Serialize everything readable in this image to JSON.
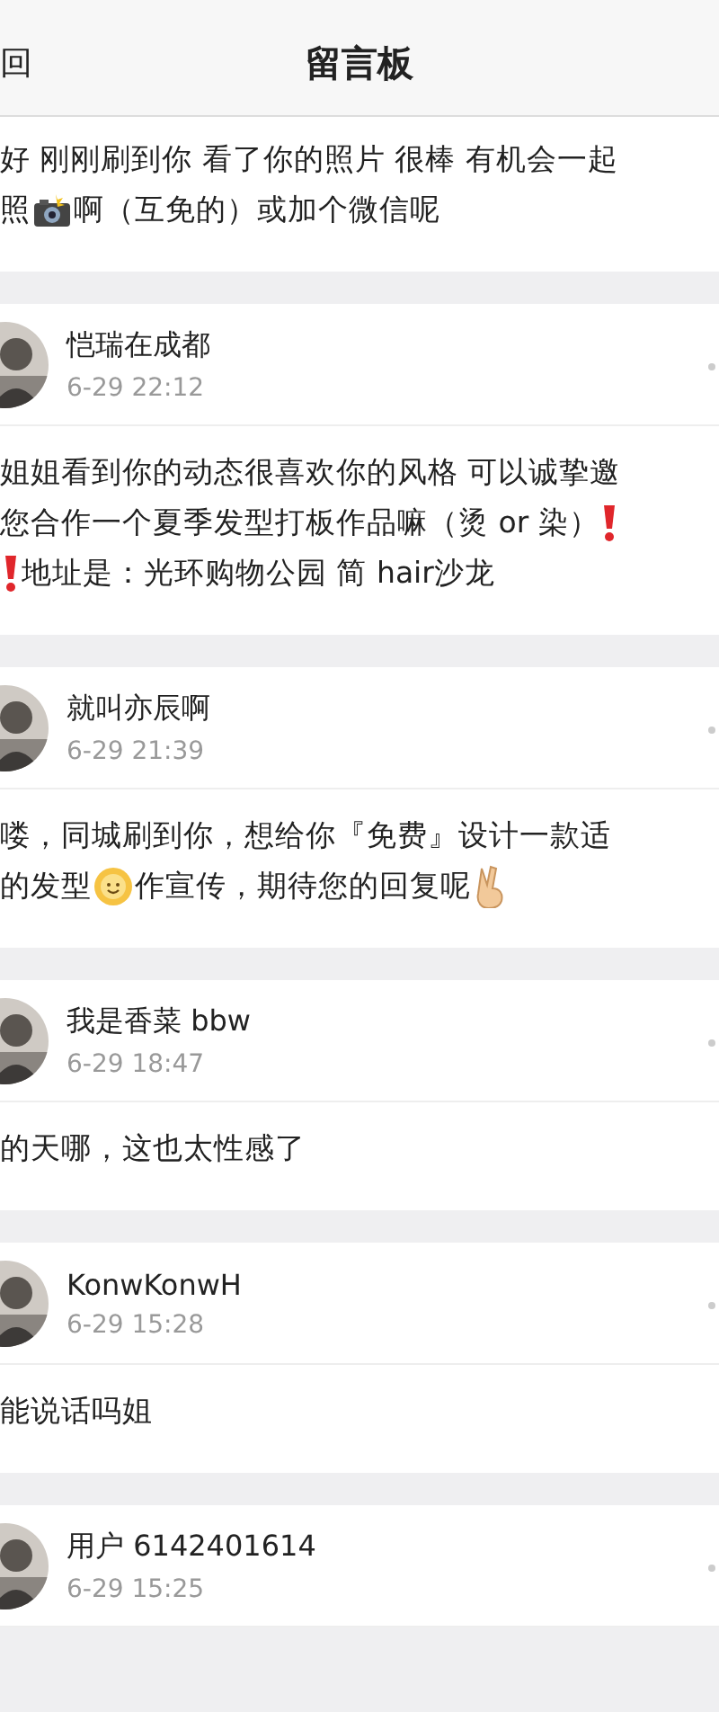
{
  "header": {
    "back": "回",
    "title": "留言板"
  },
  "messages": [
    {
      "lines": [
        [
          {
            "kind": "text",
            "text": "好  刚刚刷到你 看了你的照片 很棒 有机会一起"
          }
        ],
        [
          {
            "kind": "text",
            "text": "照"
          },
          {
            "kind": "camera"
          },
          {
            "kind": "text",
            "text": "啊（互免的）或加个微信呢"
          }
        ]
      ]
    },
    {
      "name": "恺瑞在成都",
      "time": "6-29 22:12",
      "lines": [
        [
          {
            "kind": "text",
            "text": "姐姐看到你的动态很喜欢你的风格 可以诚挚邀"
          }
        ],
        [
          {
            "kind": "text",
            "text": "您合作一个夏季发型打板作品嘛（烫 or 染）"
          },
          {
            "kind": "alert"
          }
        ],
        [
          {
            "kind": "alert"
          },
          {
            "kind": "text",
            "text": "地址是：光环购物公园 简 hair沙龙"
          }
        ]
      ]
    },
    {
      "name": "就叫亦辰啊",
      "time": "6-29 21:39",
      "lines": [
        [
          {
            "kind": "text",
            "text": "喽，同城刷到你，想给你『免费』设计一款适"
          }
        ],
        [
          {
            "kind": "text",
            "text": "的发型"
          },
          {
            "kind": "smile"
          },
          {
            "kind": "text",
            "text": "作宣传，期待您的回复呢"
          },
          {
            "kind": "victory"
          }
        ]
      ]
    },
    {
      "name": "我是香菜 bbw",
      "time": "6-29 18:47",
      "lines": [
        [
          {
            "kind": "text",
            "text": "的天哪，这也太性感了"
          }
        ]
      ]
    },
    {
      "name": "KonwKonwH",
      "time": "6-29 15:28",
      "lines": [
        [
          {
            "kind": "text",
            "text": "能说话吗姐"
          }
        ]
      ]
    },
    {
      "name": "用户 6142401614",
      "time": "6-29 15:25"
    }
  ]
}
